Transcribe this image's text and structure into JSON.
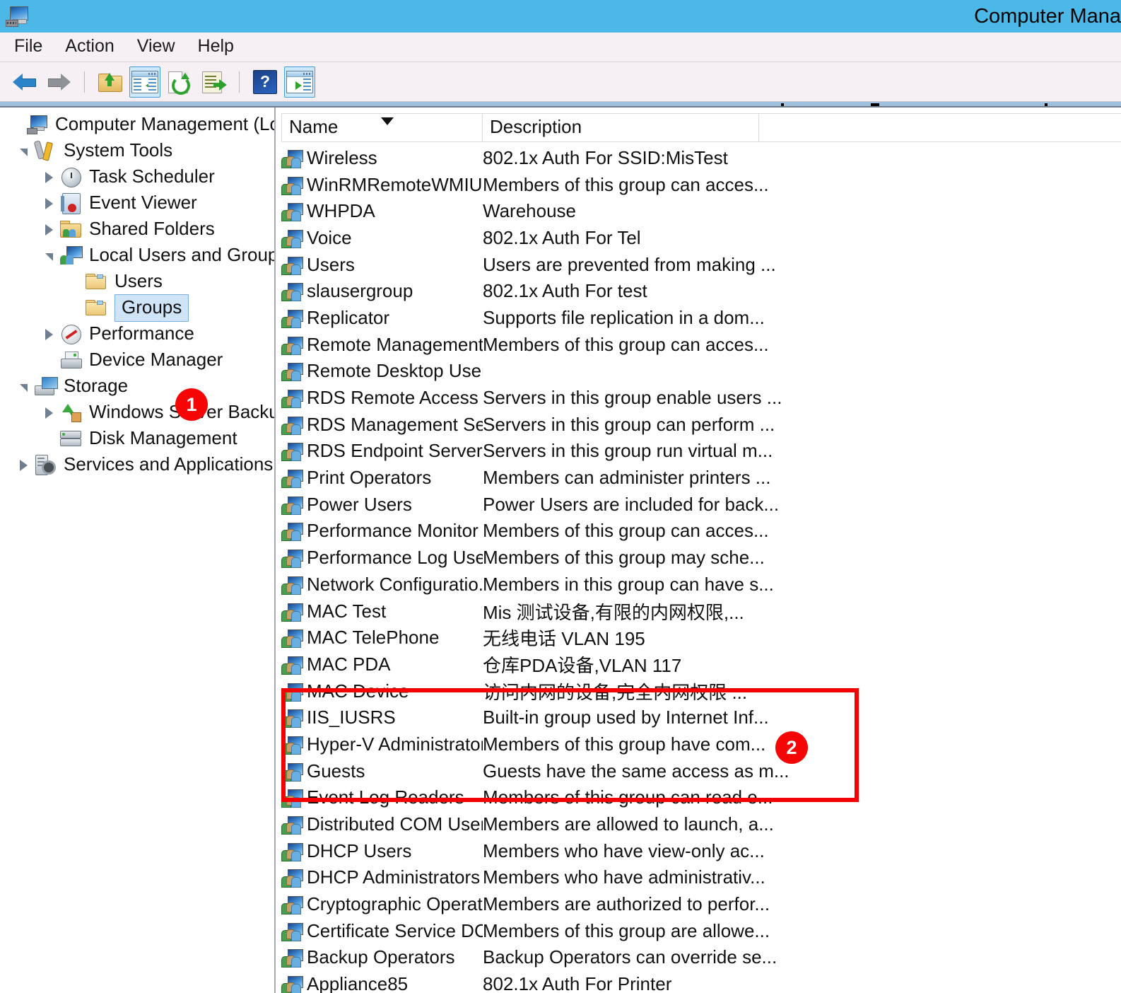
{
  "window": {
    "title": "Computer Mana",
    "app_icon": "computer-management-icon"
  },
  "menu": {
    "items": [
      "File",
      "Action",
      "View",
      "Help"
    ]
  },
  "toolbar": {
    "buttons": [
      {
        "name": "back-button",
        "icon": "back-arrow-icon"
      },
      {
        "name": "forward-button",
        "icon": "forward-arrow-icon"
      },
      {
        "name": "up-one-level-button",
        "icon": "folder-up-icon"
      },
      {
        "name": "show-hide-console-tree-button",
        "icon": "console-tree-icon"
      },
      {
        "name": "refresh-button",
        "icon": "refresh-icon"
      },
      {
        "name": "export-list-button",
        "icon": "export-list-icon"
      },
      {
        "name": "help-button",
        "icon": "help-question-icon"
      },
      {
        "name": "show-hide-action-pane-button",
        "icon": "action-pane-icon"
      }
    ]
  },
  "tree": {
    "nodes": [
      {
        "label": "Computer Management (Local)",
        "indent": 0,
        "expander": "none",
        "icon": "computer-icon",
        "selected": false
      },
      {
        "label": "System Tools",
        "indent": 1,
        "expander": "expanded",
        "icon": "system-tools-icon",
        "selected": false
      },
      {
        "label": "Task Scheduler",
        "indent": 2,
        "expander": "collapsed",
        "icon": "clock-icon",
        "selected": false
      },
      {
        "label": "Event Viewer",
        "indent": 2,
        "expander": "collapsed",
        "icon": "event-viewer-icon",
        "selected": false
      },
      {
        "label": "Shared Folders",
        "indent": 2,
        "expander": "collapsed",
        "icon": "shared-folders-icon",
        "selected": false
      },
      {
        "label": "Local Users and Groups",
        "indent": 2,
        "expander": "expanded",
        "icon": "local-users-groups-icon",
        "selected": false
      },
      {
        "label": "Users",
        "indent": 3,
        "expander": "none",
        "icon": "folder-icon",
        "selected": false
      },
      {
        "label": "Groups",
        "indent": 3,
        "expander": "none",
        "icon": "folder-icon",
        "selected": true
      },
      {
        "label": "Performance",
        "indent": 2,
        "expander": "collapsed",
        "icon": "performance-icon",
        "selected": false
      },
      {
        "label": "Device Manager",
        "indent": 2,
        "expander": "none",
        "icon": "device-manager-icon",
        "selected": false
      },
      {
        "label": "Storage",
        "indent": 1,
        "expander": "expanded",
        "icon": "storage-icon",
        "selected": false
      },
      {
        "label": "Windows Server Backup",
        "indent": 2,
        "expander": "collapsed",
        "icon": "windows-server-backup-icon",
        "selected": false
      },
      {
        "label": "Disk Management",
        "indent": 2,
        "expander": "none",
        "icon": "disk-management-icon",
        "selected": false
      },
      {
        "label": "Services and Applications",
        "indent": 1,
        "expander": "collapsed",
        "icon": "services-applications-icon",
        "selected": false
      }
    ]
  },
  "list": {
    "columns": [
      {
        "label": "Name",
        "sorted": "descending"
      },
      {
        "label": "Description",
        "sorted": "none"
      }
    ],
    "rows": [
      {
        "name": "Wireless",
        "description": "802.1x Auth For SSID:MisTest"
      },
      {
        "name": "WinRMRemoteWMIU...",
        "description": "Members of this group can acces..."
      },
      {
        "name": "WHPDA",
        "description": "Warehouse"
      },
      {
        "name": "Voice",
        "description": "802.1x Auth For Tel"
      },
      {
        "name": "Users",
        "description": "Users are prevented from making ..."
      },
      {
        "name": "slausergroup",
        "description": "802.1x Auth For test"
      },
      {
        "name": "Replicator",
        "description": "Supports file replication in a dom..."
      },
      {
        "name": "Remote Management...",
        "description": "Members of this group can acces..."
      },
      {
        "name": "Remote Desktop Users",
        "description": ""
      },
      {
        "name": "RDS Remote Access S...",
        "description": "Servers in this group enable users ..."
      },
      {
        "name": "RDS Management Ser...",
        "description": "Servers in this group can perform ..."
      },
      {
        "name": "RDS Endpoint Servers",
        "description": "Servers in this group run virtual m..."
      },
      {
        "name": "Print Operators",
        "description": "Members can administer printers ..."
      },
      {
        "name": "Power Users",
        "description": "Power Users are included for back..."
      },
      {
        "name": "Performance Monitor ...",
        "description": "Members of this group can acces..."
      },
      {
        "name": "Performance Log Users",
        "description": "Members of this group may sche..."
      },
      {
        "name": "Network Configuratio...",
        "description": "Members in this group can have s..."
      },
      {
        "name": "MAC Test",
        "description": "Mis 测试设备,有限的内网权限,..."
      },
      {
        "name": "MAC TelePhone",
        "description": "无线电话 VLAN 195"
      },
      {
        "name": "MAC PDA",
        "description": "仓库PDA设备,VLAN 117"
      },
      {
        "name": "MAC Device",
        "description": "访问内网的设备,完全内网权限 ..."
      },
      {
        "name": "IIS_IUSRS",
        "description": "Built-in group used by Internet Inf..."
      },
      {
        "name": "Hyper-V Administrators",
        "description": "Members of this group have com..."
      },
      {
        "name": "Guests",
        "description": "Guests have the same access as m..."
      },
      {
        "name": "Event Log Readers",
        "description": "Members of this group can read e..."
      },
      {
        "name": "Distributed COM Users",
        "description": "Members are allowed to launch, a..."
      },
      {
        "name": "DHCP Users",
        "description": "Members who have view-only ac..."
      },
      {
        "name": "DHCP Administrators",
        "description": "Members who have administrativ..."
      },
      {
        "name": "Cryptographic Operat...",
        "description": "Members are authorized to perfor..."
      },
      {
        "name": "Certificate Service DC...",
        "description": "Members of this group are allowe..."
      },
      {
        "name": "Backup Operators",
        "description": "Backup Operators can override se..."
      },
      {
        "name": "Appliance85",
        "description": "802.1x Auth For Printer"
      }
    ]
  },
  "annotations": {
    "color": "#f50505",
    "badges": [
      {
        "label": "1",
        "target": "tree-groups-node"
      },
      {
        "label": "2",
        "target": "mac-groups-highlight"
      }
    ],
    "highlight_box": {
      "target": "mac-groups-rows"
    }
  },
  "colors": {
    "titlebar": "#4cb8e8",
    "menubar": "#f6eff4",
    "selection": "#cfe4f7",
    "annotation_red": "#f50505",
    "splitter_blue": "#9fc0dd"
  }
}
